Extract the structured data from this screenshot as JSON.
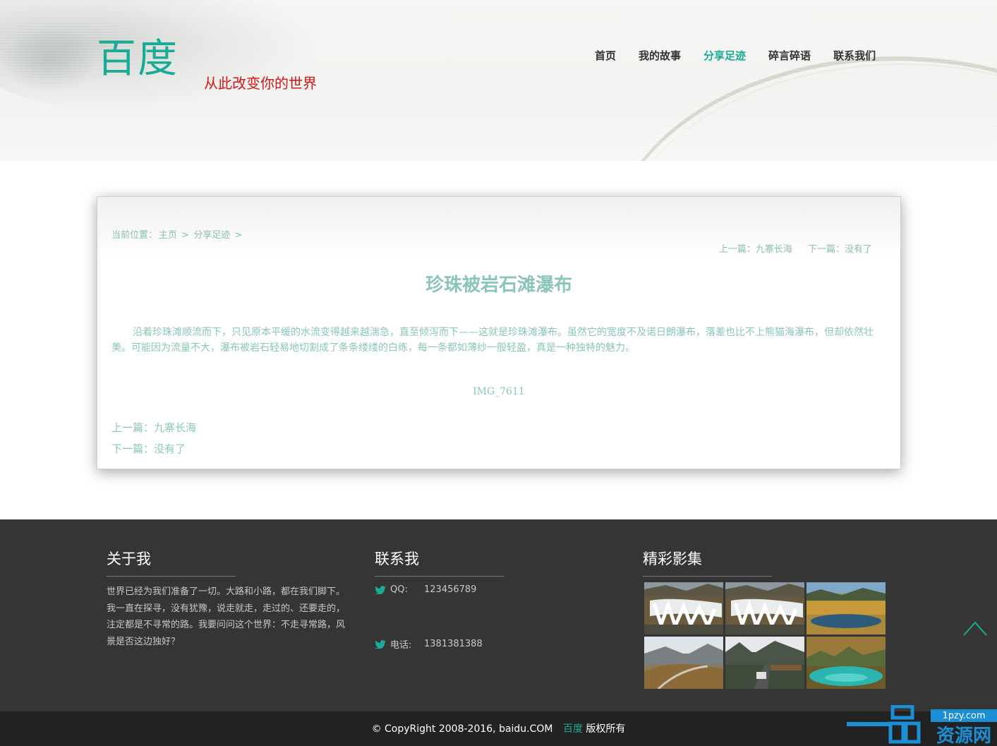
{
  "header": {
    "logo": "百度",
    "slogan": "从此改变你的世界",
    "nav": [
      "首页",
      "我的故事",
      "分享足迹",
      "碎言碎语",
      "联系我们"
    ],
    "active_index": 2
  },
  "article": {
    "breadcrumb": {
      "prefix": "当前位置：",
      "home": "主页",
      "sep1": ">",
      "section": "分享足迹",
      "sep2": ">"
    },
    "pager_top": {
      "prev": "上一篇：九寨长海",
      "next": "下一篇：没有了"
    },
    "title": "珍珠被岩石滩瀑布",
    "body": "沿着珍珠滩顺流而下，只见原本平缓的水流变得越来越湍急，直至倾泻而下——这就是珍珠滩瀑布。虽然它的宽度不及诺日朗瀑布，落差也比不上熊猫海瀑布，但却依然壮美。可能因为流量不大，瀑布被岩石轻易地切割成了条条缕缕的白练，每一条都如薄纱一般轻盈，真是一种独特的魅力。",
    "image_caption": "IMG_7611",
    "pager_bottom": {
      "prev": "上一篇：九寨长海",
      "next": "下一篇：没有了"
    }
  },
  "footer": {
    "about": {
      "title": "关于我",
      "text": "世界已经为我们准备了一切。大路和小路，都在我们脚下。我一直在探寻，没有犹豫，说走就走，走过的、还要走的，注定都是不寻常的路。我要问问这个世界：不走寻常路，风景是否这边独好？"
    },
    "contact": {
      "title": "联系我",
      "qq_label": "QQ:",
      "qq_value": "123456789",
      "phone_label": "电话:",
      "phone_value": "1381381388"
    },
    "gallery": {
      "title": "精彩影集"
    },
    "copyright": "© CopyRight 2008-2016, baidu.COM",
    "copyright_brand": "百度",
    "copyright_suffix": "版权所有"
  },
  "watermark": {
    "site": "1pzy.com",
    "name": "资源网"
  },
  "colors": {
    "accent": "#1aab97",
    "slogan": "#d21515",
    "article_text": "#8ac5ba",
    "footer_bg": "#353535",
    "copyright_bg": "#222222"
  }
}
